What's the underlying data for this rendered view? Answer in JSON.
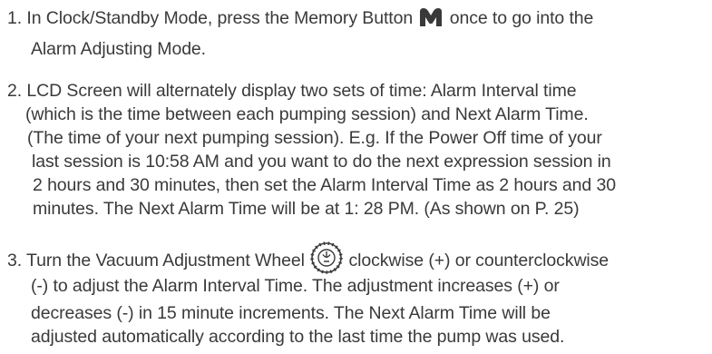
{
  "items": [
    {
      "line1_before": "1. In Clock/Standby Mode, press the Memory Button",
      "line1_after": "once to go into the",
      "line2": "Alarm Adjusting Mode."
    },
    {
      "lines": [
        "2. LCD Screen will alternately display two sets of time: Alarm Interval time",
        "(which is the time between each pumping session) and Next Alarm Time.",
        "(The time of your next pumping session).  E.g. If the Power Off time of your",
        "last  session  is 10:58 AM and you want to do the next expression session in",
        "2 hours  and 30 minutes, then set the Alarm Interval Time as 2 hours and 30",
        "minutes. The Next Alarm Time will be at 1: 28 PM. (As shown on P. 25)"
      ]
    },
    {
      "line1_before": "3. Turn the Vacuum Adjustment Wheel",
      "line1_after": "clockwise (+) or counterclockwise",
      "lines": [
        "(-) to adjust the Alarm Interval Time. The adjustment increases (+) or",
        "decreases (-) in 15 minute increments. The Next Alarm Time will be",
        "adjusted automatically according to the last time the pump was used."
      ]
    }
  ],
  "icons": {
    "memory": "memory-button-icon",
    "wheel": "vacuum-adjustment-wheel-icon"
  }
}
